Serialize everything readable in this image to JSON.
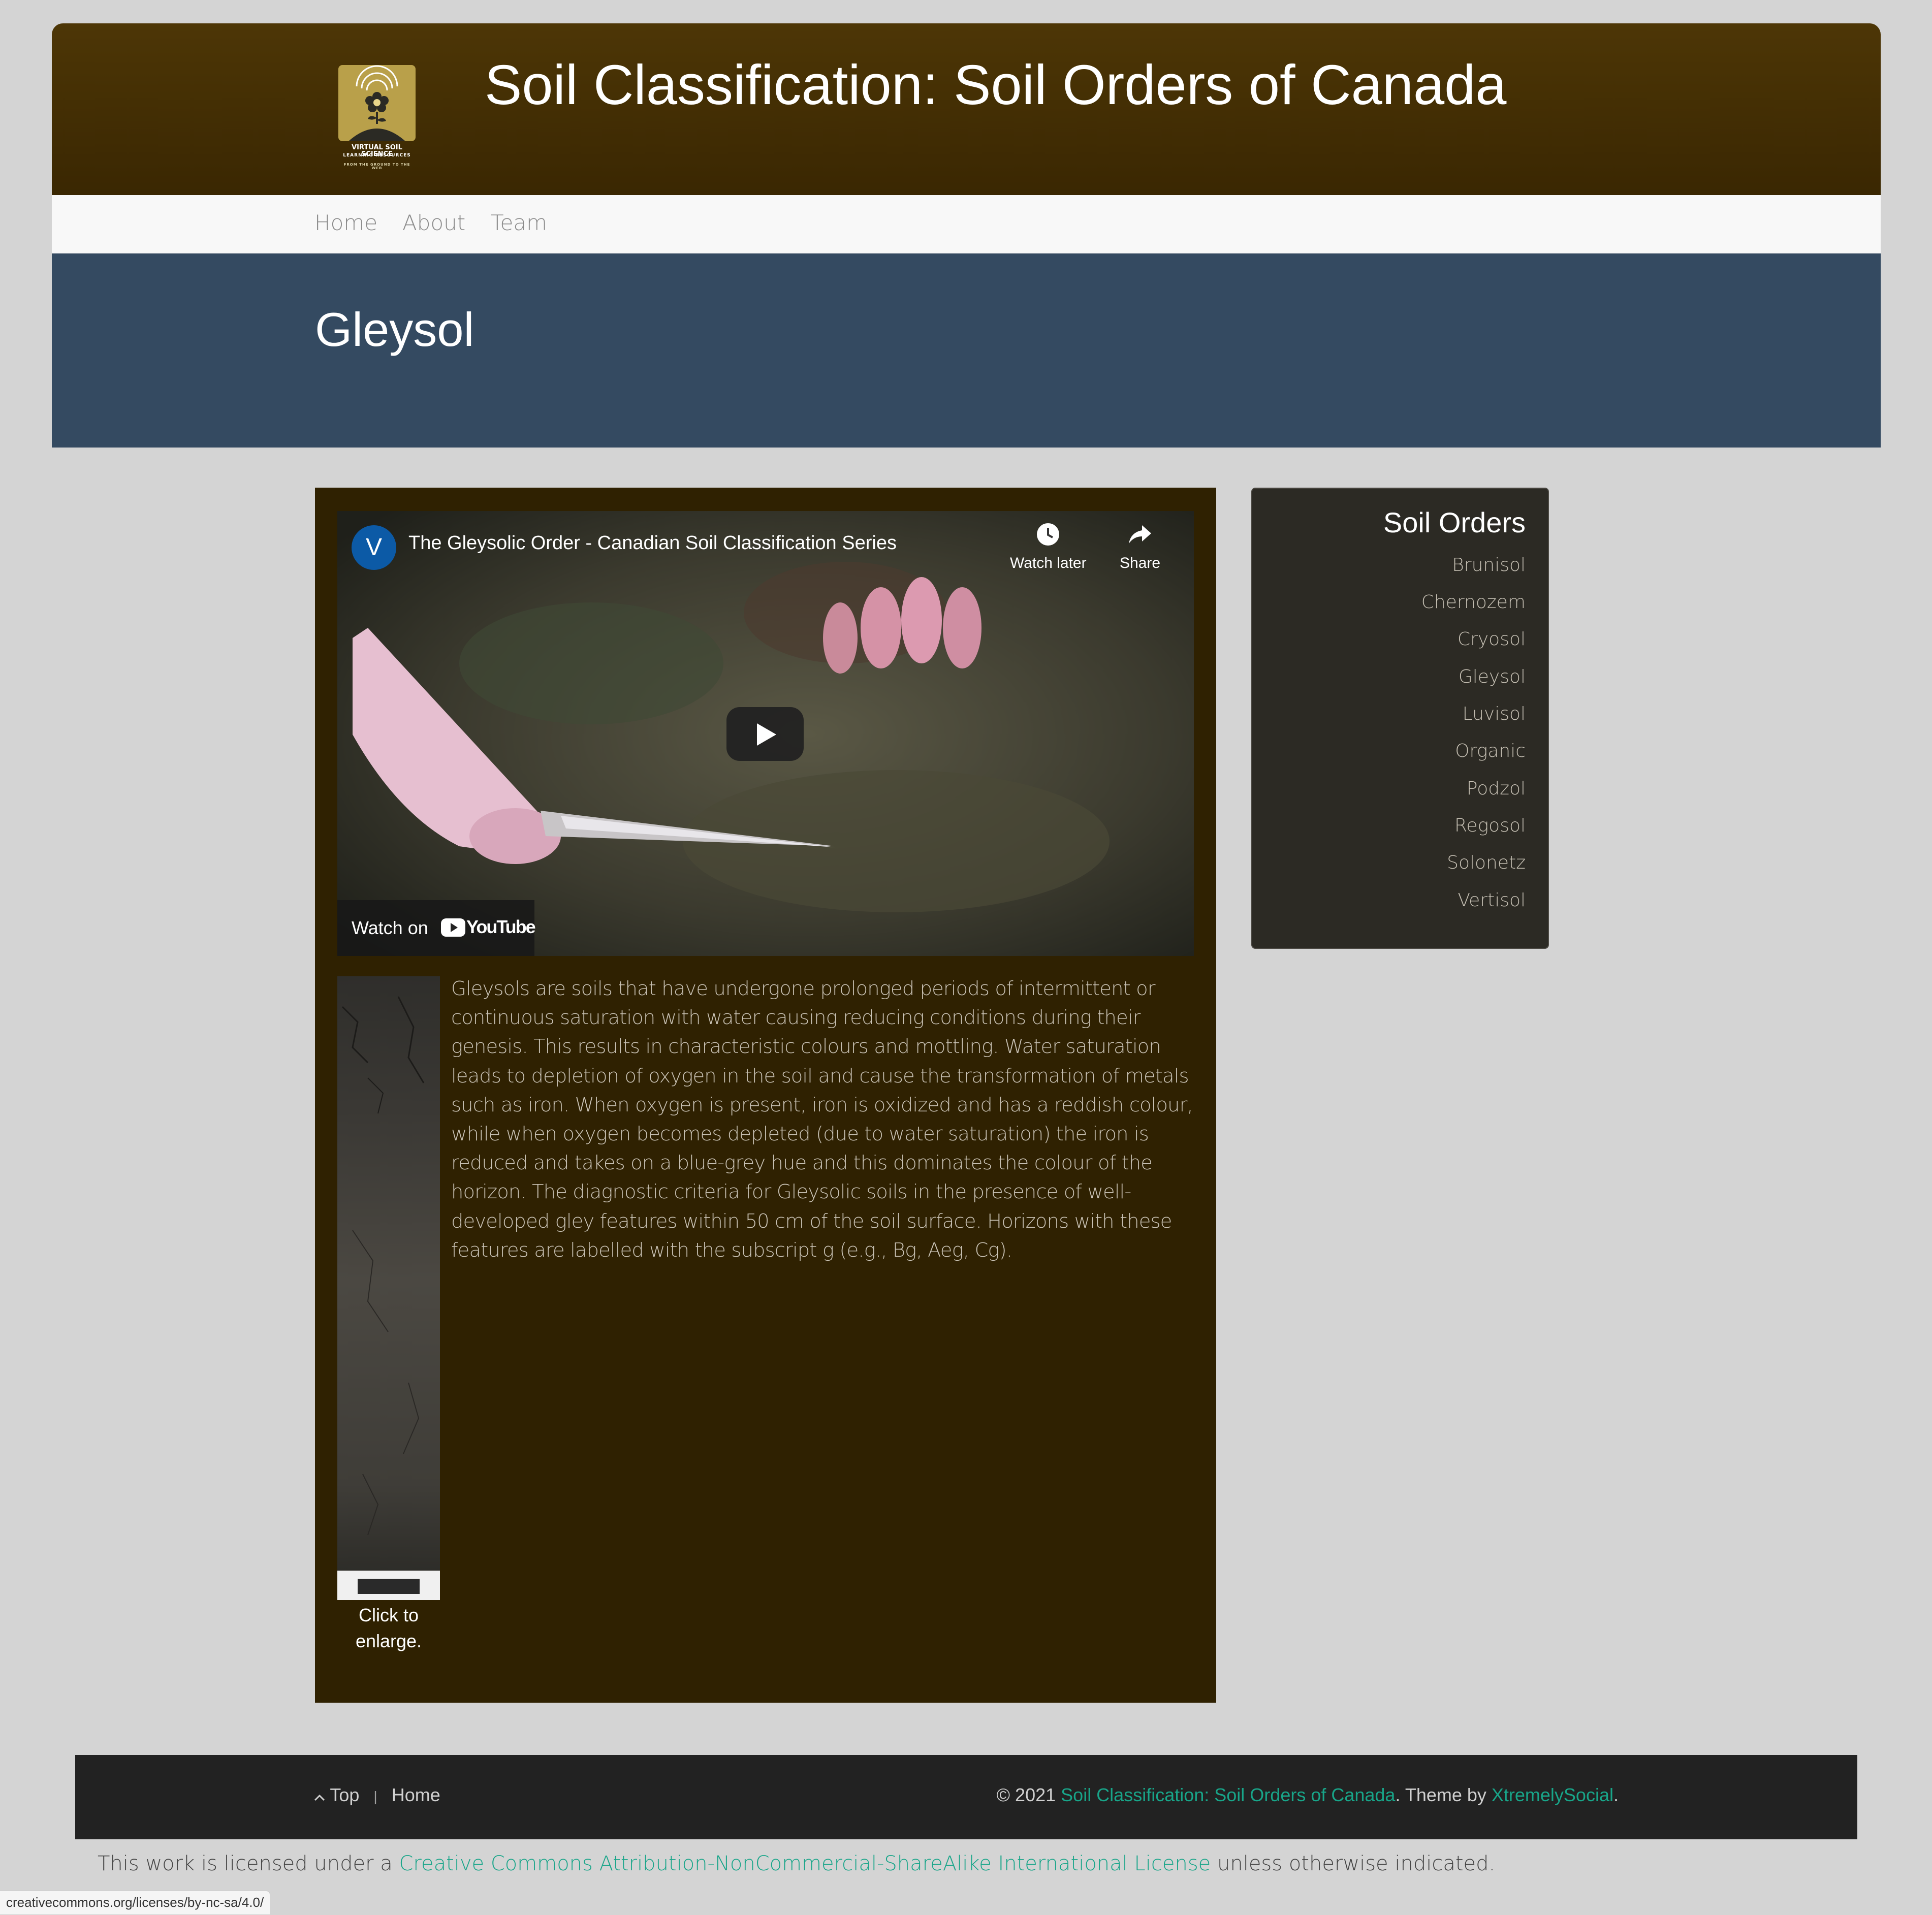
{
  "header": {
    "site_title": "Soil Classification: Soil Orders of Canada",
    "logo": {
      "line1": "VIRTUAL SOIL SCIENCE",
      "line2": "LEARNING RESOURCES",
      "line3": "FROM THE GROUND TO THE WEB"
    }
  },
  "nav": {
    "items": [
      "Home",
      "About",
      "Team"
    ]
  },
  "page": {
    "title": "Gleysol"
  },
  "video": {
    "channel_initial": "V",
    "title": "The Gleysolic Order - Canadian Soil Classification Series",
    "watch_later_label": "Watch later",
    "share_label": "Share",
    "watch_on_label": "Watch on",
    "youtube_label": "YouTube"
  },
  "profile_image": {
    "caption": "Click to enlarge."
  },
  "description": "Gleysols are soils that have undergone prolonged periods of intermittent or continuous saturation with water causing reducing conditions during their genesis. This results in characteristic colours and mottling. Water saturation leads to depletion of oxygen in the soil and cause the transformation of metals such as iron. When oxygen is present, iron is oxidized and has a reddish colour, while when oxygen becomes depleted (due to water saturation) the iron is reduced and takes on a blue-grey hue and this dominates the colour of the horizon. The diagnostic criteria for Gleysolic soils in the presence of well-developed gley features within 50 cm of the soil surface. Horizons with these features are labelled with the subscript g (e.g., Bg, Aeg, Cg).",
  "sidebar": {
    "title": "Soil Orders",
    "items": [
      "Brunisol",
      "Chernozem",
      "Cryosol",
      "Gleysol",
      "Luvisol",
      "Organic",
      "Podzol",
      "Regosol",
      "Solonetz",
      "Vertisol"
    ]
  },
  "footer": {
    "top_link": "Top",
    "separator": "|",
    "home_link": "Home",
    "copyright_prefix": "© 2021 ",
    "site_link": "Soil Classification: Soil Orders of Canada",
    "theme_text": ". Theme by ",
    "theme_link": "XtremelySocial",
    "period": "."
  },
  "license": {
    "prefix": "This work is licensed under a ",
    "link": "Creative Commons Attribution-NonCommercial-ShareAlike International License",
    "suffix": " unless otherwise indicated."
  },
  "status_bar": {
    "url": "creativecommons.org/licenses/by-nc-sa/4.0/"
  },
  "colors": {
    "header_brown": "#4d3606",
    "banner_blue": "#344a61",
    "content_brown": "#2f2101",
    "sidebar_bg": "#2c2a24",
    "footer_bg": "#222222",
    "link_teal": "#18a589"
  }
}
